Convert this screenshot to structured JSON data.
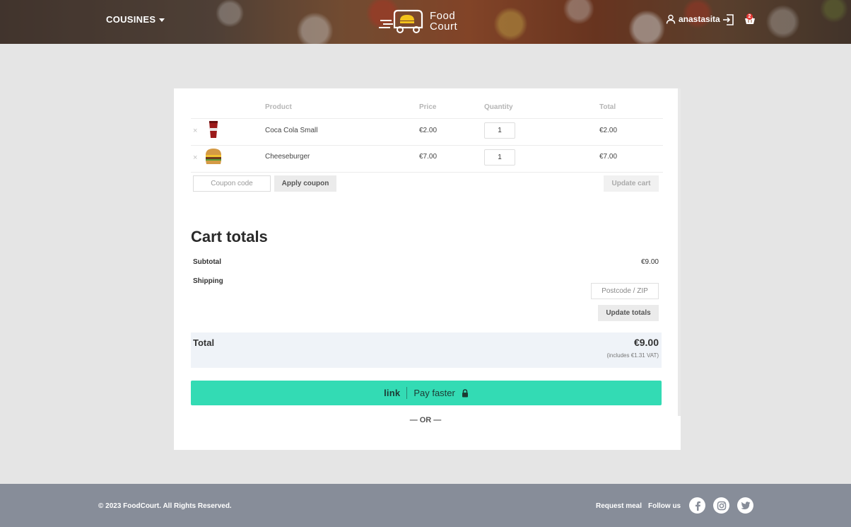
{
  "header": {
    "menu_label": "COUSINES",
    "logo_line1": "Food",
    "logo_line2": "Court",
    "username": "anastasita",
    "cart_count": "2"
  },
  "cart_table": {
    "columns": [
      "Product",
      "Price",
      "Quantity",
      "Total"
    ],
    "rows": [
      {
        "product": "Coca Cola Small",
        "price": "€2.00",
        "quantity": "1",
        "total": "€2.00",
        "remove": "×"
      },
      {
        "product": "Cheeseburger",
        "price": "€7.00",
        "quantity": "1",
        "total": "€7.00",
        "remove": "×"
      }
    ],
    "coupon_placeholder": "Coupon code",
    "apply_coupon_label": "Apply coupon",
    "update_cart_label": "Update cart"
  },
  "cart_totals": {
    "title": "Cart totals",
    "subtotal_label": "Subtotal",
    "subtotal_value": "€9.00",
    "shipping_label": "Shipping",
    "postcode_placeholder": "Postcode / ZIP",
    "update_totals_label": "Update totals",
    "total_label": "Total",
    "total_value": "€9.00",
    "vat_note": "(includes €1.31 VAT)"
  },
  "payment": {
    "link_word": "link",
    "pay_label": "Pay faster",
    "or_divider": "— OR —",
    "accent": "#33dbb4"
  },
  "footer": {
    "copyright": "© 2023 FoodCourt. All Rights Reserved.",
    "request_meal": "Request meal",
    "follow_us": "Follow us",
    "social": [
      "facebook-icon",
      "instagram-icon",
      "twitter-icon"
    ]
  }
}
